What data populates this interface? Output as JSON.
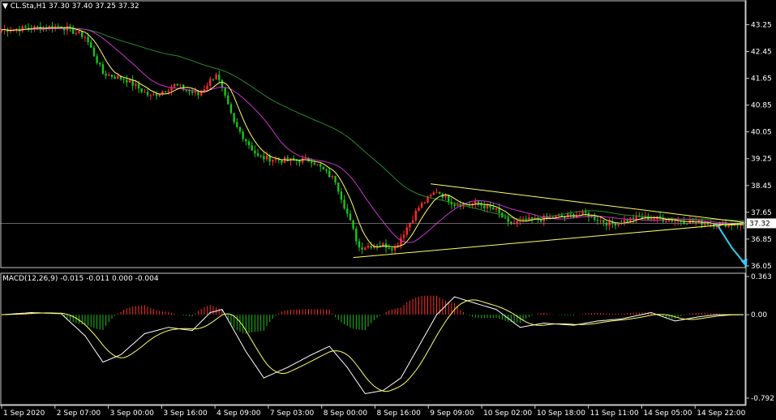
{
  "header": {
    "symbol_text": "CL.Sta,H1",
    "ohlc_text": "37.30 37.40 37.25 37.32",
    "menu_icon": "triangle-down-icon"
  },
  "macd_label": "MACD(12,26,9) -0.015 -0.011 0.000 -0.004",
  "chart_data": [
    {
      "type": "line",
      "name": "price",
      "y_ticks": [
        "43.25",
        "42.45",
        "41.65",
        "40.85",
        "40.05",
        "39.25",
        "38.45",
        "37.65",
        "36.85",
        "36.05"
      ],
      "ylim": [
        36.0,
        43.6
      ],
      "current_price_label": "37.32",
      "current_price": 37.32,
      "x_ticks": [
        "1 Sep 2020",
        "2 Sep 07:00",
        "3 Sep 00:00",
        "3 Sep 16:00",
        "4 Sep 09:00",
        "7 Sep 03:00",
        "8 Sep 00:00",
        "8 Sep 16:00",
        "9 Sep 09:00",
        "10 Sep 02:00",
        "10 Sep 18:00",
        "11 Sep 11:00",
        "14 Sep 05:00",
        "14 Sep 22:00"
      ],
      "n_bars": 250,
      "price_path": [
        [
          0,
          43.1
        ],
        [
          10,
          43.15
        ],
        [
          20,
          43.2
        ],
        [
          28,
          42.9
        ],
        [
          34,
          41.8
        ],
        [
          42,
          41.6
        ],
        [
          50,
          41.1
        ],
        [
          58,
          41.45
        ],
        [
          66,
          41.15
        ],
        [
          72,
          41.8
        ],
        [
          78,
          40.3
        ],
        [
          86,
          39.3
        ],
        [
          94,
          39.2
        ],
        [
          104,
          39.2
        ],
        [
          112,
          38.6
        ],
        [
          116,
          37.6
        ],
        [
          120,
          36.6
        ],
        [
          126,
          36.7
        ],
        [
          132,
          36.6
        ],
        [
          140,
          37.8
        ],
        [
          146,
          38.3
        ],
        [
          152,
          37.9
        ],
        [
          160,
          37.9
        ],
        [
          166,
          37.7
        ],
        [
          170,
          37.3
        ],
        [
          176,
          37.4
        ],
        [
          186,
          37.5
        ],
        [
          196,
          37.6
        ],
        [
          204,
          37.3
        ],
        [
          214,
          37.5
        ],
        [
          222,
          37.45
        ],
        [
          234,
          37.35
        ],
        [
          240,
          37.3
        ]
      ],
      "projection": [
        [
          240,
          37.3
        ],
        [
          245,
          36.6
        ],
        [
          250,
          36.05
        ]
      ],
      "triangle_upper": [
        [
          144,
          38.5
        ],
        [
          249,
          37.35
        ]
      ],
      "triangle_lower": [
        [
          118,
          36.3
        ],
        [
          249,
          37.33
        ]
      ],
      "colors": {
        "up": "#ff2b2b",
        "down": "#18c418",
        "ma_fast": "#ffff66",
        "ma_mid": "#cc33cc",
        "ma_slow": "#2a8a2a",
        "triangle": "#ffff66",
        "projection": "#33ccee",
        "grid": "#555555"
      }
    },
    {
      "type": "bar",
      "name": "MACD",
      "y_ticks": [
        "0.363",
        "0.00",
        "-0.792"
      ],
      "ylim": [
        -0.792,
        0.363
      ],
      "macd_path": [
        [
          0,
          0.0
        ],
        [
          10,
          0.02
        ],
        [
          20,
          0.01
        ],
        [
          28,
          -0.2
        ],
        [
          34,
          -0.45
        ],
        [
          40,
          -0.38
        ],
        [
          48,
          -0.18
        ],
        [
          56,
          -0.12
        ],
        [
          64,
          -0.15
        ],
        [
          70,
          0.02
        ],
        [
          74,
          0.05
        ],
        [
          82,
          -0.35
        ],
        [
          88,
          -0.6
        ],
        [
          96,
          -0.5
        ],
        [
          104,
          -0.38
        ],
        [
          110,
          -0.3
        ],
        [
          116,
          -0.5
        ],
        [
          122,
          -0.75
        ],
        [
          128,
          -0.72
        ],
        [
          134,
          -0.6
        ],
        [
          140,
          -0.3
        ],
        [
          146,
          0.0
        ],
        [
          152,
          0.17
        ],
        [
          160,
          0.1
        ],
        [
          166,
          0.05
        ],
        [
          174,
          -0.12
        ],
        [
          182,
          -0.08
        ],
        [
          192,
          -0.1
        ],
        [
          200,
          -0.06
        ],
        [
          208,
          -0.04
        ],
        [
          218,
          0.02
        ],
        [
          226,
          -0.06
        ],
        [
          234,
          -0.02
        ],
        [
          240,
          0.0
        ]
      ],
      "colors": {
        "hist_up": "#ff2b2b",
        "hist_down": "#18c418",
        "signal": "#ffff66",
        "macd": "#ffffff",
        "zero": "#555555"
      }
    }
  ]
}
